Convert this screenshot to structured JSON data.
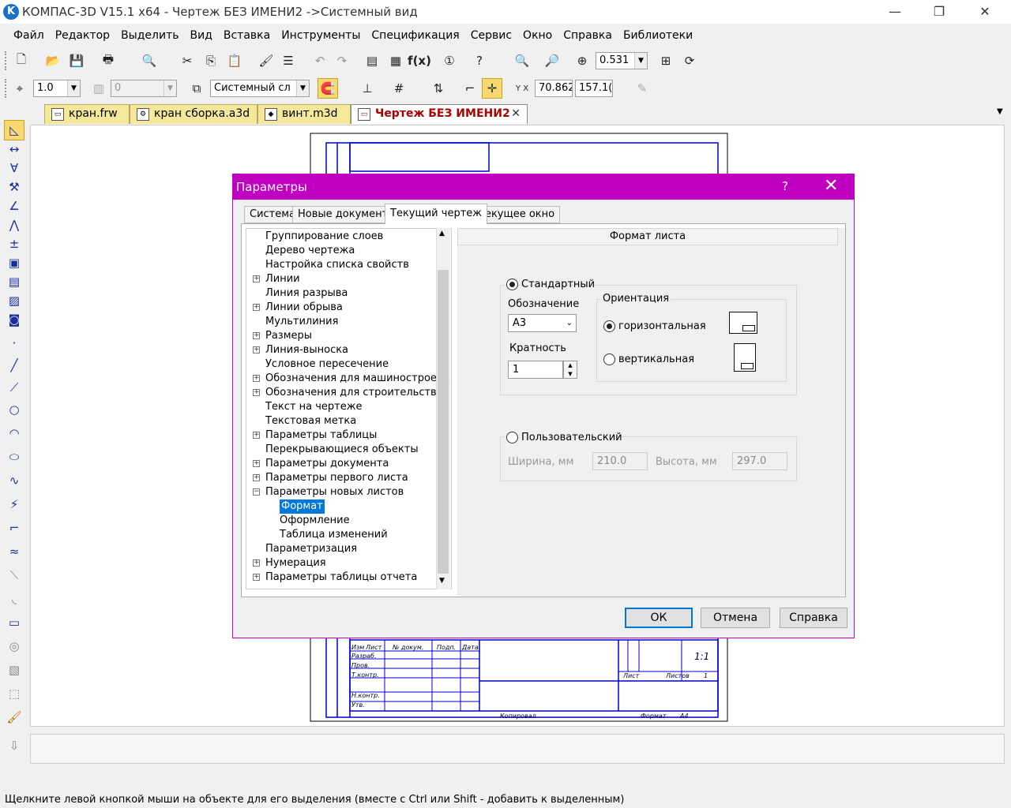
{
  "window": {
    "title": "КОМПАС-3D V15.1 x64 - Чертеж БЕЗ ИМЕНИ2 ->Системный вид",
    "minimize": "—",
    "maximize": "❐",
    "close": "✕"
  },
  "menu": [
    "Файл",
    "Редактор",
    "Выделить",
    "Вид",
    "Вставка",
    "Инструменты",
    "Спецификация",
    "Сервис",
    "Окно",
    "Справка",
    "Библиотеки"
  ],
  "toolbar": {
    "zoom_value": "0.531",
    "line_scale": "1.0",
    "layer_value": "0",
    "view_name": "Системный сл",
    "coord_x": "70.862",
    "coord_y": "157.1("
  },
  "doc_tabs": [
    {
      "label": "кран.frw",
      "icon": "drawing-icon"
    },
    {
      "label": "кран сборка.a3d",
      "icon": "assembly-icon"
    },
    {
      "label": "винт.m3d",
      "icon": "part-icon"
    },
    {
      "label": "Чертеж БЕЗ ИМЕНИ2",
      "icon": "drawing-icon",
      "active": true
    }
  ],
  "status_text": "Щелкните левой кнопкой мыши на объекте для его выделения (вместе с Ctrl или Shift - добавить к выделенным)",
  "dialog": {
    "title": "Параметры",
    "help": "?",
    "close": "✕",
    "tabs": [
      "Система",
      "Новые документы",
      "Текущий чертеж",
      "Текущее окно"
    ],
    "active_tab": "Текущий чертеж",
    "tree": [
      {
        "label": "Группирование слоев",
        "exp": ""
      },
      {
        "label": "Дерево чертежа",
        "exp": ""
      },
      {
        "label": "Настройка списка свойств",
        "exp": ""
      },
      {
        "label": "Линии",
        "exp": "+"
      },
      {
        "label": "Линия разрыва",
        "exp": ""
      },
      {
        "label": "Линии обрыва",
        "exp": "+"
      },
      {
        "label": "Мультилиния",
        "exp": ""
      },
      {
        "label": "Размеры",
        "exp": "+"
      },
      {
        "label": "Линия-выноска",
        "exp": "+"
      },
      {
        "label": "Условное пересечение",
        "exp": ""
      },
      {
        "label": "Обозначения для машиностроения",
        "exp": "+"
      },
      {
        "label": "Обозначения для строительства",
        "exp": "+"
      },
      {
        "label": "Текст на чертеже",
        "exp": ""
      },
      {
        "label": "Текстовая метка",
        "exp": ""
      },
      {
        "label": "Параметры таблицы",
        "exp": "+"
      },
      {
        "label": "Перекрывающиеся объекты",
        "exp": ""
      },
      {
        "label": "Параметры документа",
        "exp": "+"
      },
      {
        "label": "Параметры первого листа",
        "exp": "+"
      },
      {
        "label": "Параметры новых листов",
        "exp": "−"
      },
      {
        "label": "Формат",
        "exp": "",
        "child": true,
        "selected": true
      },
      {
        "label": "Оформление",
        "exp": "",
        "child": true
      },
      {
        "label": "Таблица изменений",
        "exp": "",
        "child": true
      },
      {
        "label": "Параметризация",
        "exp": ""
      },
      {
        "label": "Нумерация",
        "exp": "+"
      },
      {
        "label": "Параметры таблицы отчета",
        "exp": "+"
      }
    ],
    "section_header": "Формат листа",
    "standard": {
      "label": "Стандартный",
      "selected": true,
      "designation_label": "Обозначение",
      "designation_value": "А3",
      "multiplicity_label": "Кратность",
      "multiplicity_value": "1"
    },
    "orientation": {
      "label": "Ориентация",
      "horizontal": "горизонтальная",
      "vertical": "вертикальная",
      "selected": "horizontal"
    },
    "custom": {
      "label": "Пользовательский",
      "selected": false,
      "width_label": "Ширина, мм",
      "width_value": "210.0",
      "height_label": "Высота, мм",
      "height_value": "297.0"
    },
    "buttons": {
      "ok": "ОК",
      "cancel": "Отмена",
      "help": "Справка"
    }
  },
  "drawing_text": {
    "format": "Формат",
    "format_value": "А4",
    "copied": "Копировал",
    "scale": "1:1",
    "sheet": "Лист",
    "sheets": "Листов",
    "sheets_value": "1",
    "row1": "Изм",
    "row1b": "Лист",
    "row1c": "№ докум.",
    "row1d": "Подп.",
    "row1e": "Дата",
    "r2": "Разраб.",
    "r3": "Пров.",
    "r4": "Т.контр.",
    "r5": "Н.контр.",
    "r6": "Утв."
  },
  "colors": {
    "accent": "#c000c0",
    "drawing_line": "#0000cc",
    "selection": "#0078d7",
    "tab_bg": "#f6e89a"
  }
}
